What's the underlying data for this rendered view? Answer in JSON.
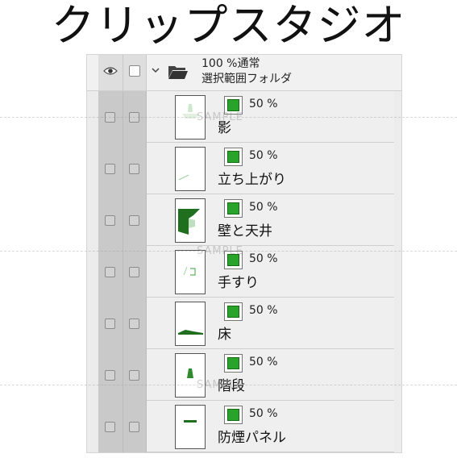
{
  "title": "クリップスタジオ",
  "folder": {
    "opacity_mode": "100 %通常",
    "name": "選択範囲フォルダ"
  },
  "layers": [
    {
      "name": "影",
      "opacity": "50 %"
    },
    {
      "name": "立ち上がり",
      "opacity": "50 %"
    },
    {
      "name": "壁と天井",
      "opacity": "50 %"
    },
    {
      "name": "手すり",
      "opacity": "50 %"
    },
    {
      "name": "床",
      "opacity": "50 %"
    },
    {
      "name": "階段",
      "opacity": "50 %"
    },
    {
      "name": "防煙パネル",
      "opacity": "50 %"
    }
  ],
  "watermark": "SAMPLE",
  "icons": {
    "eye": "eye-icon",
    "checkbox": "checkbox-icon",
    "chevron": "chevron-down-icon",
    "folder": "folder-open-icon",
    "mask": "layer-mask-icon"
  },
  "colors": {
    "mask_green": "#29a329",
    "column_gray": "#c9c9c9",
    "row_bg": "#efefef"
  }
}
